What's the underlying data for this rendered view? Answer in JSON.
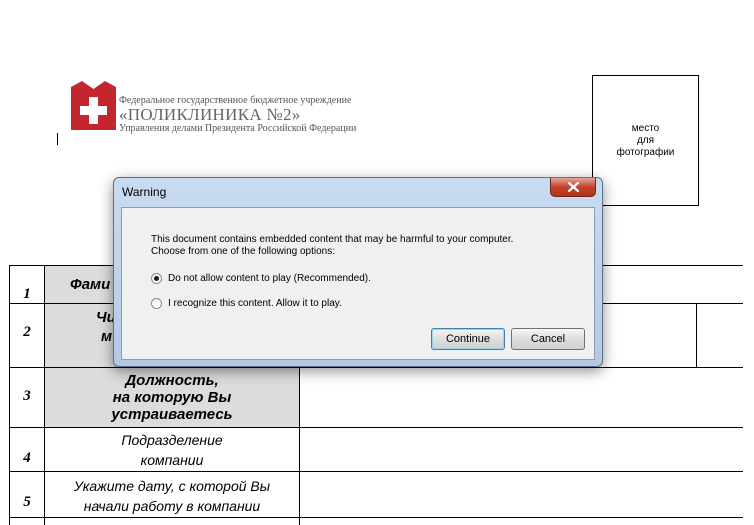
{
  "document": {
    "org": {
      "line1": "Федеральное государственное бюджетное учреждение",
      "line2": "«ПОЛИКЛИНИКА №2»",
      "line3": "Управления делами Президента Российской Федерации"
    },
    "photo_placeholder": [
      "место",
      "для",
      "фотографии"
    ],
    "rows": [
      {
        "num": "1",
        "label_visible": "Фами"
      },
      {
        "num": "2",
        "label_visible_1": "Чи",
        "label_visible_2": "м"
      },
      {
        "num": "3",
        "label": [
          "Должность,",
          "на которую Вы",
          "устраиваетесь"
        ]
      },
      {
        "num": "4",
        "label": [
          "Подразделение",
          "компании"
        ]
      },
      {
        "num": "5",
        "label": [
          "Укажите дату, с которой Вы",
          "начали работу в компании"
        ]
      }
    ]
  },
  "dialog": {
    "title": "Warning",
    "message_line1": "This document contains embedded content that may be harmful to your computer.",
    "message_line2": "Choose from one of the following options:",
    "option1": "Do not allow content to play (Recommended).",
    "option2": "I recognize this content. Allow it to play.",
    "selected_option": 1,
    "continue_label": "Continue",
    "cancel_label": "Cancel",
    "close_icon": "close-icon"
  },
  "colors": {
    "logo_red": "#c4262e",
    "dialog_frame": "#b9cde6",
    "close_red": "#c4442c",
    "label_grey": "#dcdcdc"
  }
}
